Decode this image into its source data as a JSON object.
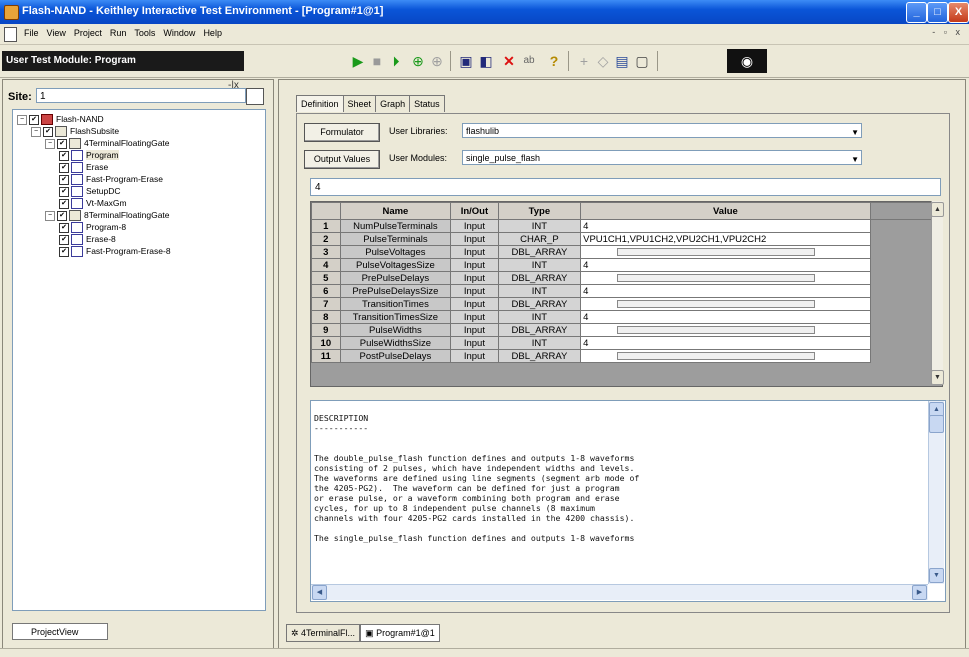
{
  "window": {
    "title": "Flash-NAND - Keithley Interactive Test Environment - [Program#1@1]",
    "minimize_glyph": "_",
    "maximize_glyph": "□",
    "close_glyph": "X",
    "mdi_controls": "- ▫ x"
  },
  "menu": {
    "items": [
      "File",
      "View",
      "Project",
      "Run",
      "Tools",
      "Window",
      "Help"
    ]
  },
  "toolbar": {
    "module_label": "User Test Module: Program",
    "icons": [
      "run-icon",
      "stop-icon",
      "run-step-icon",
      "append-icon",
      "append-disabled-icon",
      "save-icon",
      "save-all-icon",
      "delete-icon",
      "rename-icon",
      "help-icon",
      "add-disabled-icon",
      "settings-disabled-icon",
      "graph-icon",
      "report-icon",
      "keithley-logo-icon"
    ]
  },
  "left": {
    "site_label": "Site:",
    "site_value": "1",
    "tree": [
      {
        "level": 0,
        "label": "Flash-NAND",
        "expander": "−",
        "check": "✔",
        "icon": "root"
      },
      {
        "level": 1,
        "label": "FlashSubsite",
        "expander": "−",
        "check": "✔",
        "icon": "gate"
      },
      {
        "level": 2,
        "label": "4TerminalFloatingGate",
        "expander": "−",
        "check": "✔",
        "icon": "gate"
      },
      {
        "level": 3,
        "label": "Program",
        "expander": "",
        "check": "✔",
        "icon": "prog",
        "selected": true
      },
      {
        "level": 3,
        "label": "Erase",
        "expander": "",
        "check": "✔",
        "icon": "prog"
      },
      {
        "level": 3,
        "label": "Fast-Program-Erase",
        "expander": "",
        "check": "✔",
        "icon": "prog"
      },
      {
        "level": 3,
        "label": "SetupDC",
        "expander": "",
        "check": "✔",
        "icon": "prog"
      },
      {
        "level": 3,
        "label": "Vt-MaxGm",
        "expander": "",
        "check": "✔",
        "icon": "prog"
      },
      {
        "level": 2,
        "label": "8TerminalFloatingGate",
        "expander": "−",
        "check": "✔",
        "icon": "gate"
      },
      {
        "level": 3,
        "label": "Program-8",
        "expander": "",
        "check": "✔",
        "icon": "prog"
      },
      {
        "level": 3,
        "label": "Erase-8",
        "expander": "",
        "check": "✔",
        "icon": "prog"
      },
      {
        "level": 3,
        "label": "Fast-Program-Erase-8",
        "expander": "",
        "check": "✔",
        "icon": "prog"
      }
    ],
    "bottom_tab": "ProjectView",
    "pane_controls": "-|x"
  },
  "right": {
    "tabs": [
      "Definition",
      "Sheet",
      "Graph",
      "Status"
    ],
    "active_tab": "Definition",
    "formulator_button": "Formulator",
    "user_libraries_label": "User Libraries:",
    "user_libraries_value": "flashulib",
    "output_values_button": "Output Values",
    "user_modules_label": "User Modules:",
    "user_modules_value": "single_pulse_flash",
    "edit_value": "4",
    "grid": {
      "headers": [
        "",
        "Name",
        "In/Out",
        "Type",
        "Value"
      ],
      "rows": [
        {
          "num": "1",
          "name": "NumPulseTerminals",
          "io": "Input",
          "type": "INT",
          "value": "4",
          "array": false
        },
        {
          "num": "2",
          "name": "PulseTerminals",
          "io": "Input",
          "type": "CHAR_P",
          "value": "VPU1CH1,VPU1CH2,VPU2CH1,VPU2CH2",
          "array": false
        },
        {
          "num": "3",
          "name": "PulseVoltages",
          "io": "Input",
          "type": "DBL_ARRAY",
          "value": "",
          "array": true
        },
        {
          "num": "4",
          "name": "PulseVoltagesSize",
          "io": "Input",
          "type": "INT",
          "value": "4",
          "array": false
        },
        {
          "num": "5",
          "name": "PrePulseDelays",
          "io": "Input",
          "type": "DBL_ARRAY",
          "value": "",
          "array": true
        },
        {
          "num": "6",
          "name": "PrePulseDelaysSize",
          "io": "Input",
          "type": "INT",
          "value": "4",
          "array": false
        },
        {
          "num": "7",
          "name": "TransitionTimes",
          "io": "Input",
          "type": "DBL_ARRAY",
          "value": "",
          "array": true
        },
        {
          "num": "8",
          "name": "TransitionTimesSize",
          "io": "Input",
          "type": "INT",
          "value": "4",
          "array": false
        },
        {
          "num": "9",
          "name": "PulseWidths",
          "io": "Input",
          "type": "DBL_ARRAY",
          "value": "",
          "array": true
        },
        {
          "num": "10",
          "name": "PulseWidthsSize",
          "io": "Input",
          "type": "INT",
          "value": "4",
          "array": false
        },
        {
          "num": "11",
          "name": "PostPulseDelays",
          "io": "Input",
          "type": "DBL_ARRAY",
          "value": "",
          "array": true
        }
      ]
    },
    "description": "DESCRIPTION\n-----------\n\n\nThe double_pulse_flash function defines and outputs 1-8 waveforms\nconsisting of 2 pulses, which have independent widths and levels.\nThe waveforms are defined using line segments (segment arb mode of\nthe 4205-PG2).  The waveform can be defined for just a program\nor erase pulse, or a waveform combining both program and erase\ncycles, for up to 8 independent pulse channels (8 maximum\nchannels with four 4205-PG2 cards installed in the 4200 chassis).\n\nThe single_pulse_flash function defines and outputs 1-8 waveforms",
    "doc_tabs": [
      "4TerminalFl...",
      "Program#1@1"
    ]
  }
}
